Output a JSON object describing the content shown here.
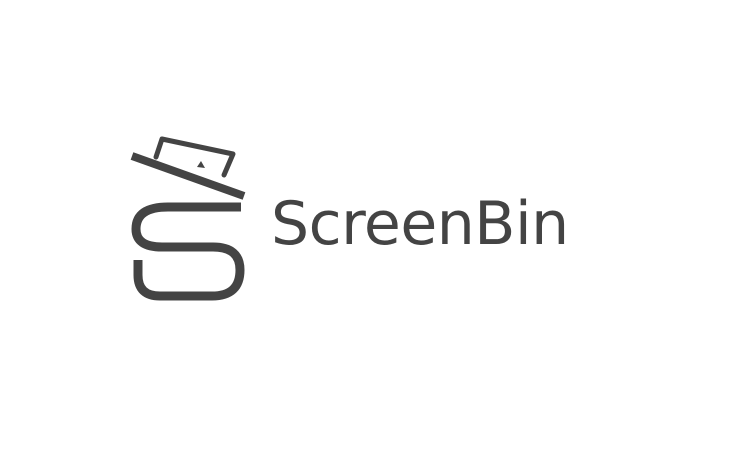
{
  "brand": {
    "name": "ScreenBin",
    "color": "#444444",
    "icon": "screenbin-logo-icon"
  }
}
